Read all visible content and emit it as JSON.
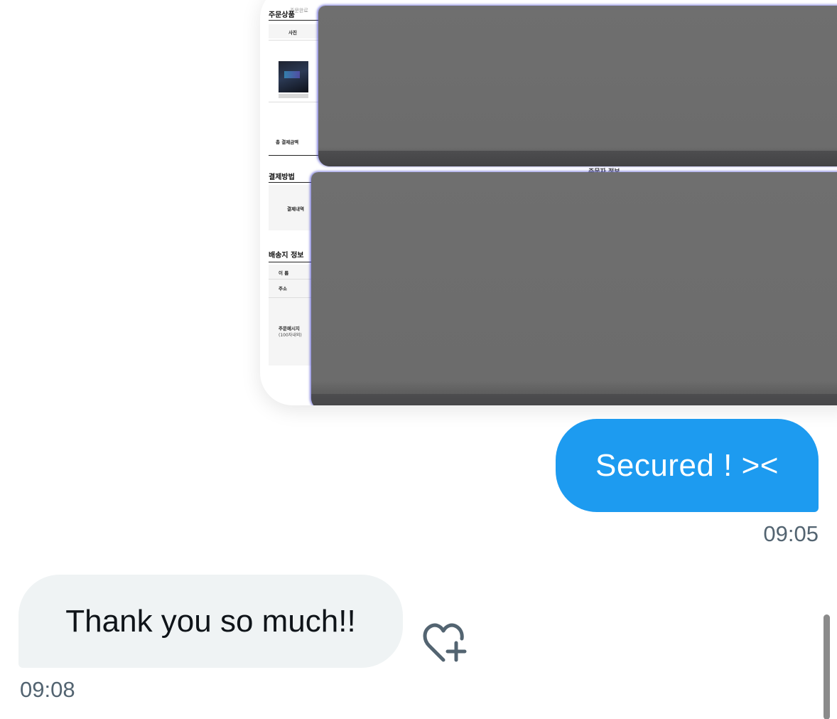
{
  "shared_image": {
    "breadcrumb": "주문완료",
    "sections": {
      "order_items": "주문상품",
      "photo_label": "사진",
      "total_payment": "총 결제금액",
      "payment_method": "결제방법",
      "payment_details": "결제내역",
      "partial_heading": "주문자 정보",
      "shipping_info": "배송지 정보",
      "name_label": "이 름",
      "address_label": "주소",
      "message_label": "주문메시지",
      "message_note": "(100자내외)"
    },
    "redacted": true
  },
  "messages": [
    {
      "direction": "outgoing",
      "text": "Secured ! ><",
      "time": "09:05",
      "bubble_color": "#1d9bf0"
    },
    {
      "direction": "incoming",
      "text": "Thank you so much!!",
      "time": "09:08",
      "bubble_color": "#eff3f4"
    }
  ],
  "actions": {
    "add_reaction_icon": "heart-plus-icon"
  },
  "colors": {
    "accent": "#1d9bf0",
    "timestamp": "#536471",
    "incoming_text": "#0f1419"
  }
}
